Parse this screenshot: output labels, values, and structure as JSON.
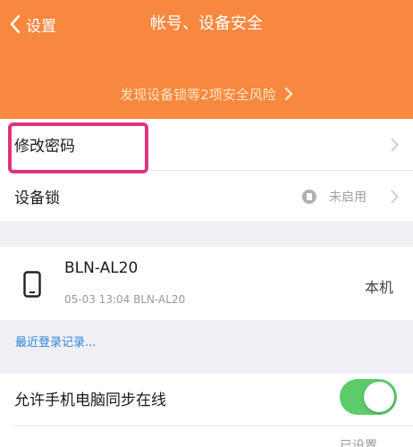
{
  "header": {
    "back_label": "设置",
    "title": "帐号、设备安全",
    "risk_banner": "发现设备锁等2项安全风险",
    "background_color": "#f8883f"
  },
  "settings": {
    "change_password": "修改密码",
    "device_lock": {
      "label": "设备锁",
      "status": "未启用"
    }
  },
  "device": {
    "name": "BLN-AL20",
    "detail": "05-03 13:04 BLN-AL20",
    "tag": "本机",
    "icon": "phone-icon"
  },
  "recent_login_link": "最近登录记录...",
  "sync_online": {
    "label": "允许手机电脑同步在线",
    "enabled": true
  },
  "partial_bottom_text": "已设置",
  "colors": {
    "accent": "#f8883f",
    "highlight": "#e0357a",
    "link": "#2e86de",
    "toggle_on": "#5ccb6a"
  }
}
